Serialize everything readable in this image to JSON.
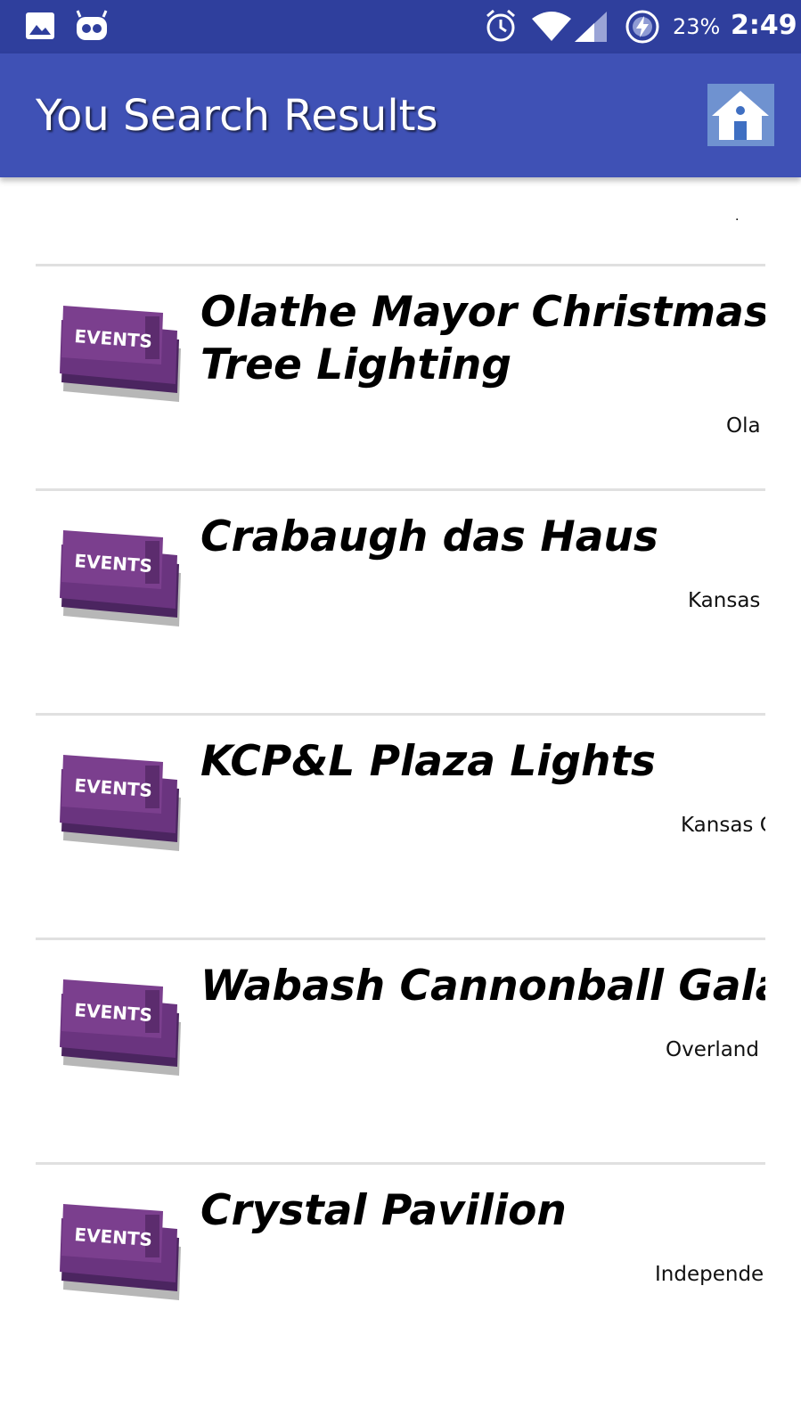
{
  "status_bar": {
    "battery": "23%",
    "time": "2:49",
    "icons": [
      "image-icon",
      "robot-icon",
      "alarm-icon",
      "wifi-icon",
      "signal-icon",
      "charging-icon"
    ]
  },
  "app_bar": {
    "title": "You Search Results",
    "home_icon": "home-icon"
  },
  "list": {
    "top_fragment": ".",
    "items": [
      {
        "title": "Olathe Mayor Christmas Tree Lighting",
        "location": "Ola",
        "thumb_label": "EVENTS"
      },
      {
        "title": "Crabaugh das Haus",
        "location": "Kansas",
        "thumb_label": "EVENTS"
      },
      {
        "title": "KCP&L Plaza Lights",
        "location": "Kansas C",
        "thumb_label": "EVENTS"
      },
      {
        "title": "Wabash Cannonball Gala",
        "location": "Overland P",
        "thumb_label": "EVENTS"
      },
      {
        "title": "Crystal Pavilion",
        "location": "Independen",
        "thumb_label": "EVENTS"
      }
    ]
  },
  "colors": {
    "status_bar": "#2f3f9d",
    "app_bar": "#3f51b5",
    "ticket_purple": "#7b3f8e",
    "divider": "#e0e0e0"
  }
}
